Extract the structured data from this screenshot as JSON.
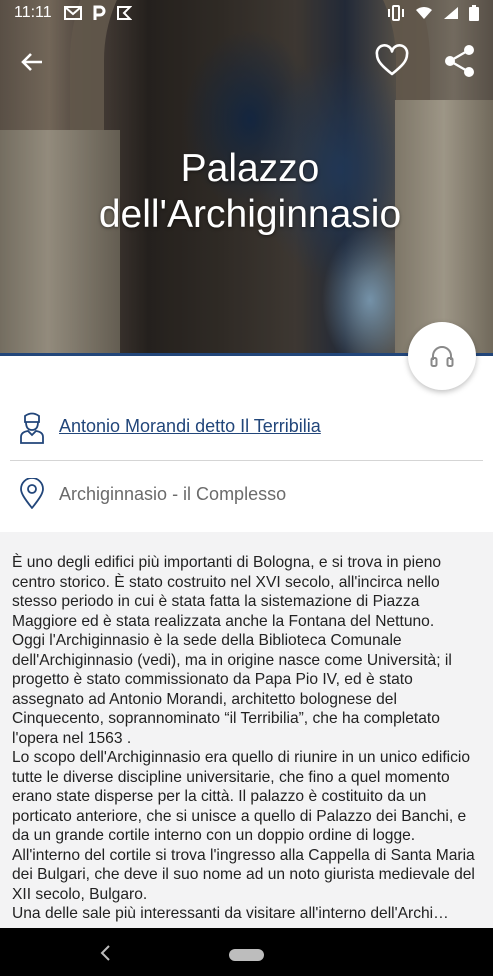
{
  "status_bar": {
    "time": "11:11",
    "left_icons": [
      "gmail-icon",
      "p-app-icon",
      "flag-app-icon"
    ],
    "right_icons": [
      "vibrate-icon",
      "wifi-icon",
      "signal-icon",
      "battery-icon"
    ]
  },
  "hero": {
    "title_line1": "Palazzo",
    "title_line2": "dell'Archiginnasio"
  },
  "actions": {
    "back_icon": "arrow-back-icon",
    "favorite_icon": "heart-outline-icon",
    "share_icon": "share-icon",
    "audio_icon": "headphones-icon"
  },
  "info": {
    "author": "Antonio Morandi detto Il Terribilia",
    "place": "Archiginnasio - il Complesso"
  },
  "description": {
    "p1": "È uno degli edifici più importanti di Bologna, e si trova in pieno centro storico. È stato costruito nel XVI secolo, all'incirca nello stesso periodo in cui è stata fatta la sistemazione di Piazza Maggiore ed è stata realizzata anche la Fontana del Nettuno.",
    "p2": "Oggi l'Archiginnasio è la sede della Biblioteca Comunale dell'Archiginnasio (vedi), ma in origine nasce come Università; il progetto è stato commissionato da Papa Pio IV, ed è stato assegnato ad Antonio Morandi, architetto bolognese del Cinquecento, soprannominato “il Terribilia”, che ha completato l'opera nel 1563 .",
    "p3": "Lo scopo dell'Archiginnasio era quello di riunire in un unico edificio tutte le diverse discipline universitarie, che fino a quel momento erano state disperse per la città. Il palazzo è costituito da un porticato anteriore, che si unisce a quello di Palazzo dei Banchi, e da un grande cortile interno con un doppio ordine di logge. All'interno del cortile si trova l'ingresso alla Cappella di Santa Maria dei Bulgari, che deve il suo nome ad un noto giurista medievale del XII secolo, Bulgaro.",
    "p4": "Una delle sale più interessanti da visitare all'interno dell'Archi…"
  },
  "nav_bar": {
    "back_icon": "nav-back-icon",
    "home_icon": "nav-home-pill"
  },
  "colors": {
    "accent": "#22467a",
    "link": "#22467a",
    "secondary_text": "#6b6b6b",
    "background": "#f3f3f4"
  }
}
